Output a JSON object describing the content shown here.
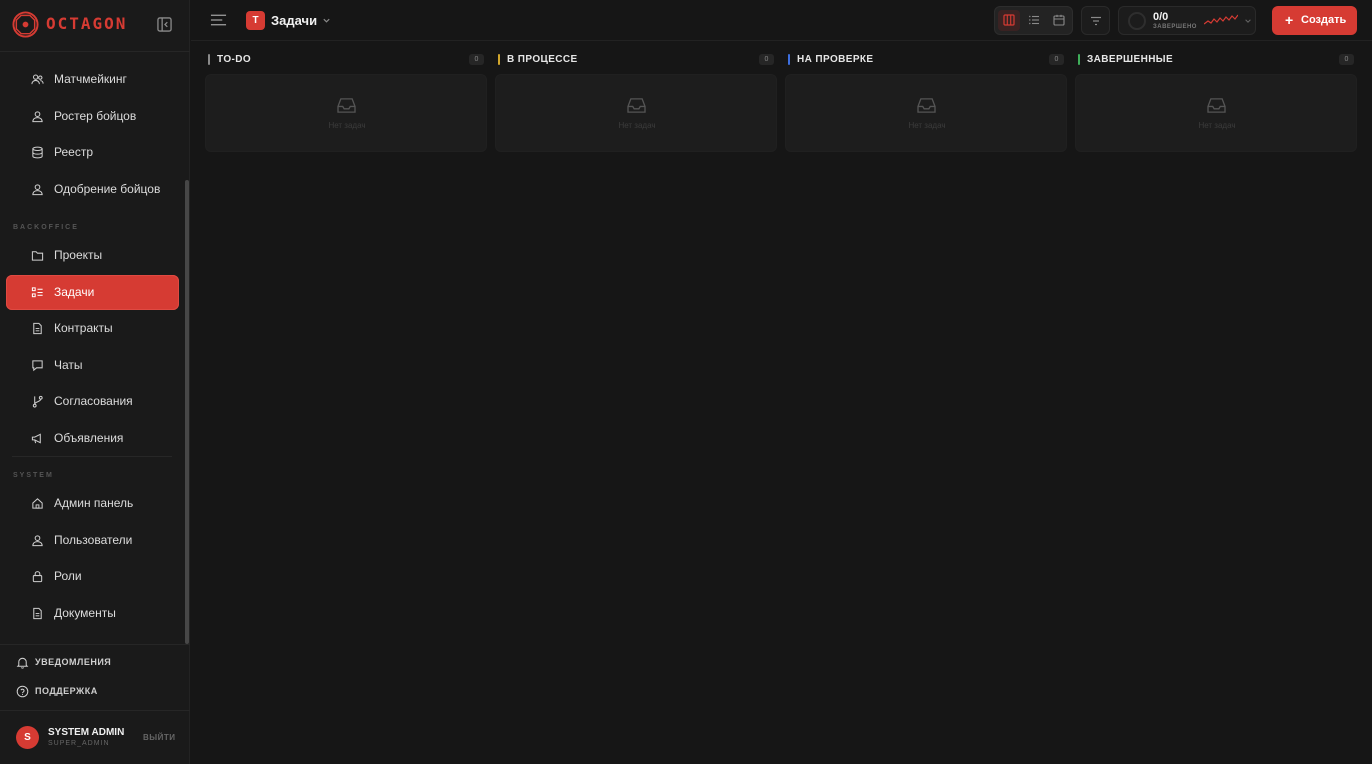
{
  "brand": {
    "name": "OCTAGON",
    "accent_color": "#d63b33"
  },
  "sidebar": {
    "items_top": [
      {
        "label": "Матчмейкинг",
        "icon": "users-icon"
      },
      {
        "label": "Ростер бойцов",
        "icon": "user-icon"
      },
      {
        "label": "Реестр",
        "icon": "database-icon"
      },
      {
        "label": "Одобрение бойцов",
        "icon": "user-check-icon"
      }
    ],
    "section_backoffice": "BACKOFFICE",
    "items_backoffice": [
      {
        "label": "Проекты",
        "icon": "folder-icon"
      },
      {
        "label": "Задачи",
        "icon": "tasks-icon",
        "active": true
      },
      {
        "label": "Контракты",
        "icon": "document-icon"
      },
      {
        "label": "Чаты",
        "icon": "chat-icon"
      },
      {
        "label": "Согласования",
        "icon": "git-branch-icon"
      },
      {
        "label": "Объявления",
        "icon": "megaphone-icon"
      }
    ],
    "section_system": "SYSTEM",
    "items_system": [
      {
        "label": "Админ панель",
        "icon": "home-icon"
      },
      {
        "label": "Пользователи",
        "icon": "user-icon"
      },
      {
        "label": "Роли",
        "icon": "lock-icon"
      },
      {
        "label": "Документы",
        "icon": "document-icon"
      }
    ],
    "notifications_label": "УВЕДОМЛЕНИЯ",
    "support_label": "ПОДДЕРЖКА",
    "user": {
      "initial": "S",
      "name": "SYSTEM ADMIN",
      "role": "SUPER_ADMIN",
      "logout_label": "ВЫЙТИ"
    }
  },
  "header": {
    "page_badge": "T",
    "page_title": "Задачи",
    "view_modes": [
      "board",
      "list",
      "calendar"
    ],
    "active_view": "board",
    "progress": {
      "count": "0/0",
      "label": "ЗАВЕРШЕНО"
    },
    "create_label": "Создать"
  },
  "board": {
    "columns": [
      {
        "title": "TO-DO",
        "count": "0",
        "color": "#8a8a8a",
        "empty_text": "Нет задач"
      },
      {
        "title": "В ПРОЦЕССЕ",
        "count": "0",
        "color": "#d2a72c",
        "empty_text": "Нет задач"
      },
      {
        "title": "НА ПРОВЕРКЕ",
        "count": "0",
        "color": "#3d6fe0",
        "empty_text": "Нет задач"
      },
      {
        "title": "ЗАВЕРШЕННЫЕ",
        "count": "0",
        "color": "#3fae5a",
        "empty_text": "Нет задач"
      }
    ]
  }
}
